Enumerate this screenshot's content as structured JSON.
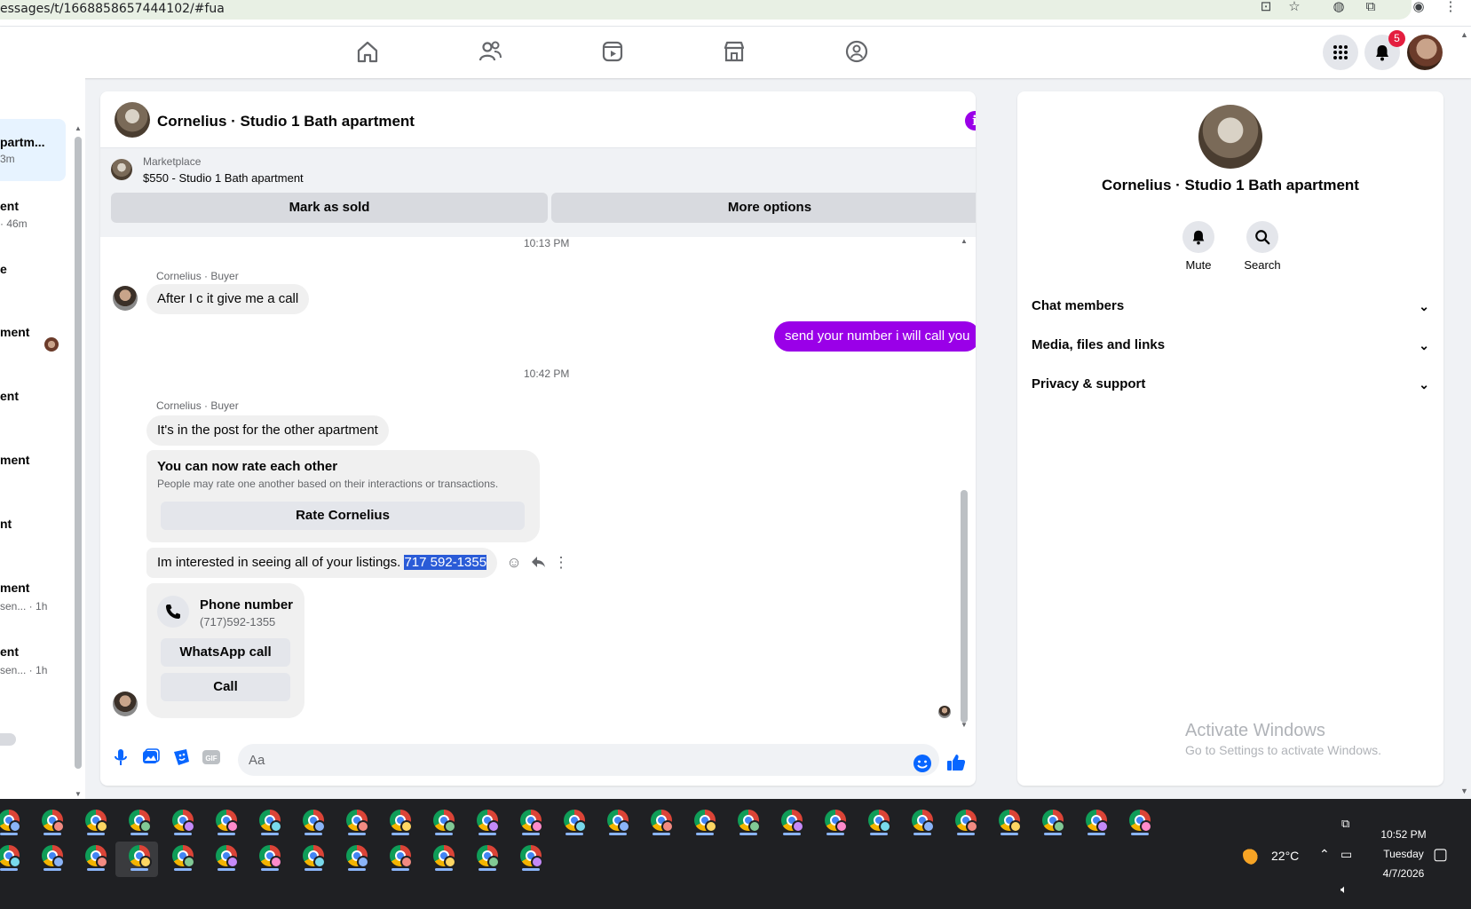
{
  "browser": {
    "url": "essages/t/1668858657444102/#fua"
  },
  "topnav": {
    "icons": [
      "home-icon",
      "friends-icon",
      "watch-icon",
      "marketplace-icon",
      "groups-icon"
    ],
    "notifications_count": "5"
  },
  "left_list": {
    "items": [
      {
        "title": "partm...",
        "sub": "3m"
      },
      {
        "title": "ent",
        "sub": "· 46m"
      },
      {
        "title": "e",
        "sub": ""
      },
      {
        "title": "ment",
        "sub": ""
      },
      {
        "title": "ent",
        "sub": ""
      },
      {
        "title": "ment",
        "sub": ""
      },
      {
        "title": "nt",
        "sub": ""
      },
      {
        "title": "ment",
        "sub": "sen... · 1h"
      },
      {
        "title": "ent",
        "sub": "sen... · 1h"
      }
    ]
  },
  "chat": {
    "title": "Cornelius · Studio 1 Bath apartment",
    "marketplace_label": "Marketplace",
    "listing": "$550 - Studio 1 Bath apartment",
    "mark_sold": "Mark as sold",
    "more_options": "More options",
    "timestamp1": "10:13 PM",
    "sender1": "Cornelius · Buyer",
    "msg1": "After I c it give me a call",
    "my_msg": "send your number i will call you",
    "timestamp2": "10:42 PM",
    "sender2": "Cornelius · Buyer",
    "msg2": "It's in the post for the other apartment",
    "rate_title": "You can now rate each other",
    "rate_desc": "People may rate one another based on their interactions or transactions.",
    "rate_button": "Rate Cornelius",
    "msg3_prefix": "Im interested in seeing all of your listings. ",
    "msg3_selected": "717 592-1355",
    "phone_title": "Phone number",
    "phone_value": "(717)592-1355",
    "whatsapp_call": "WhatsApp call",
    "call": "Call",
    "composer_placeholder": "Aa"
  },
  "info_panel": {
    "title": "Cornelius · Studio 1 Bath apartment",
    "mute": "Mute",
    "search": "Search",
    "rows": [
      "Chat members",
      "Media, files and links",
      "Privacy & support"
    ]
  },
  "watermark": {
    "line1": "Activate Windows",
    "line2": "Go to Settings to activate Windows."
  },
  "taskbar": {
    "weather": "22°C",
    "time": "10:52 PM",
    "day": "Tuesday",
    "date": "4/7/2026"
  },
  "colors": {
    "accent": "#9a00e8",
    "selection": "#2a5bd7",
    "notification": "#e41e3f"
  }
}
